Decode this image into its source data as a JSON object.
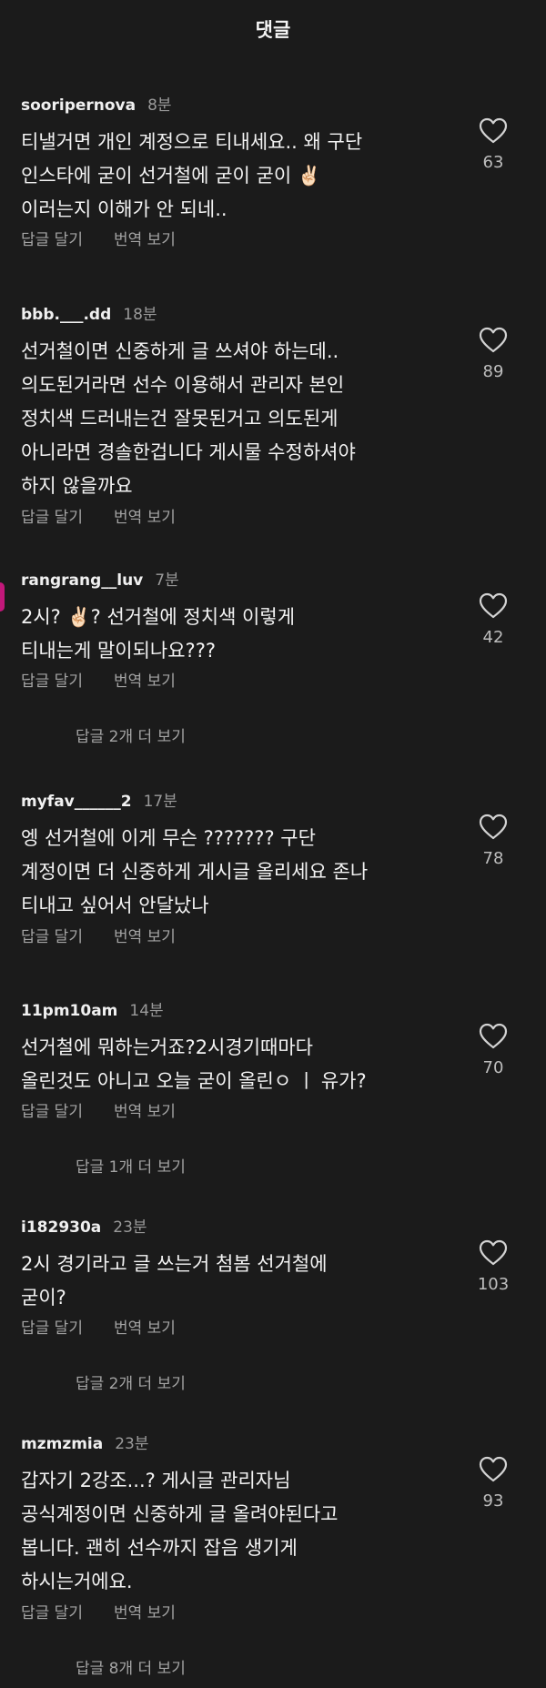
{
  "header": {
    "title": "댓글"
  },
  "common": {
    "reply_label": "답글 달기",
    "translate_label": "번역 보기"
  },
  "comments": [
    {
      "username": "sooripernova",
      "time": "8분",
      "text": "티낼거면 개인 계정으로 티내세요.. 왜 구단\n인스타에 굳이 선거철에 굳이 굳이 ✌🏻\n이러는지 이해가 안 되네..",
      "likes": "63"
    },
    {
      "username": "bbb.___.dd",
      "time": "18분",
      "text": "선거철이면 신중하게 글 쓰셔야 하는데..\n의도된거라면 선수 이용해서 관리자 본인\n정치색 드러내는건 잘못된거고 의도된게\n아니라면 경솔한겁니다 게시물 수정하셔야\n하지 않을까요",
      "likes": "89"
    },
    {
      "username": "rangrang__luv",
      "time": "7분",
      "text": "2시? ✌🏻? 선거철에 정치색 이렇게\n티내는게  말이되나요???",
      "likes": "42",
      "replies": "답글 2개 더 보기"
    },
    {
      "username": "myfav______2",
      "time": "17분",
      "text": "엥 선거철에 이게 무슨 ??????? 구단\n계정이면 더 신중하게 게시글 올리세요 존나\n티내고 싶어서 안달났나",
      "likes": "78"
    },
    {
      "username": "11pm10am",
      "time": "14분",
      "text": "선거철에 뭐하는거죠?2시경기때마다\n올린것도 아니고 오늘 굳이 올린ㅇ ㅣ 유가?",
      "likes": "70",
      "replies": "답글 1개 더 보기"
    },
    {
      "username": "i182930a",
      "time": "23분",
      "text": "2시 경기라고 글 쓰는거 첨봄 선거철에\n굳이?",
      "likes": "103",
      "replies": "답글 2개 더 보기"
    },
    {
      "username": "mzmzmia",
      "time": "23분",
      "text": "갑자기 2강조...? 게시글 관리자님\n공식계정이면 신중하게 글 올려야된다고\n봅니다. 괜히 선수까지 잡음 생기게\n하시는거에요.",
      "likes": "93",
      "replies": "답글 8개 더 보기"
    }
  ]
}
